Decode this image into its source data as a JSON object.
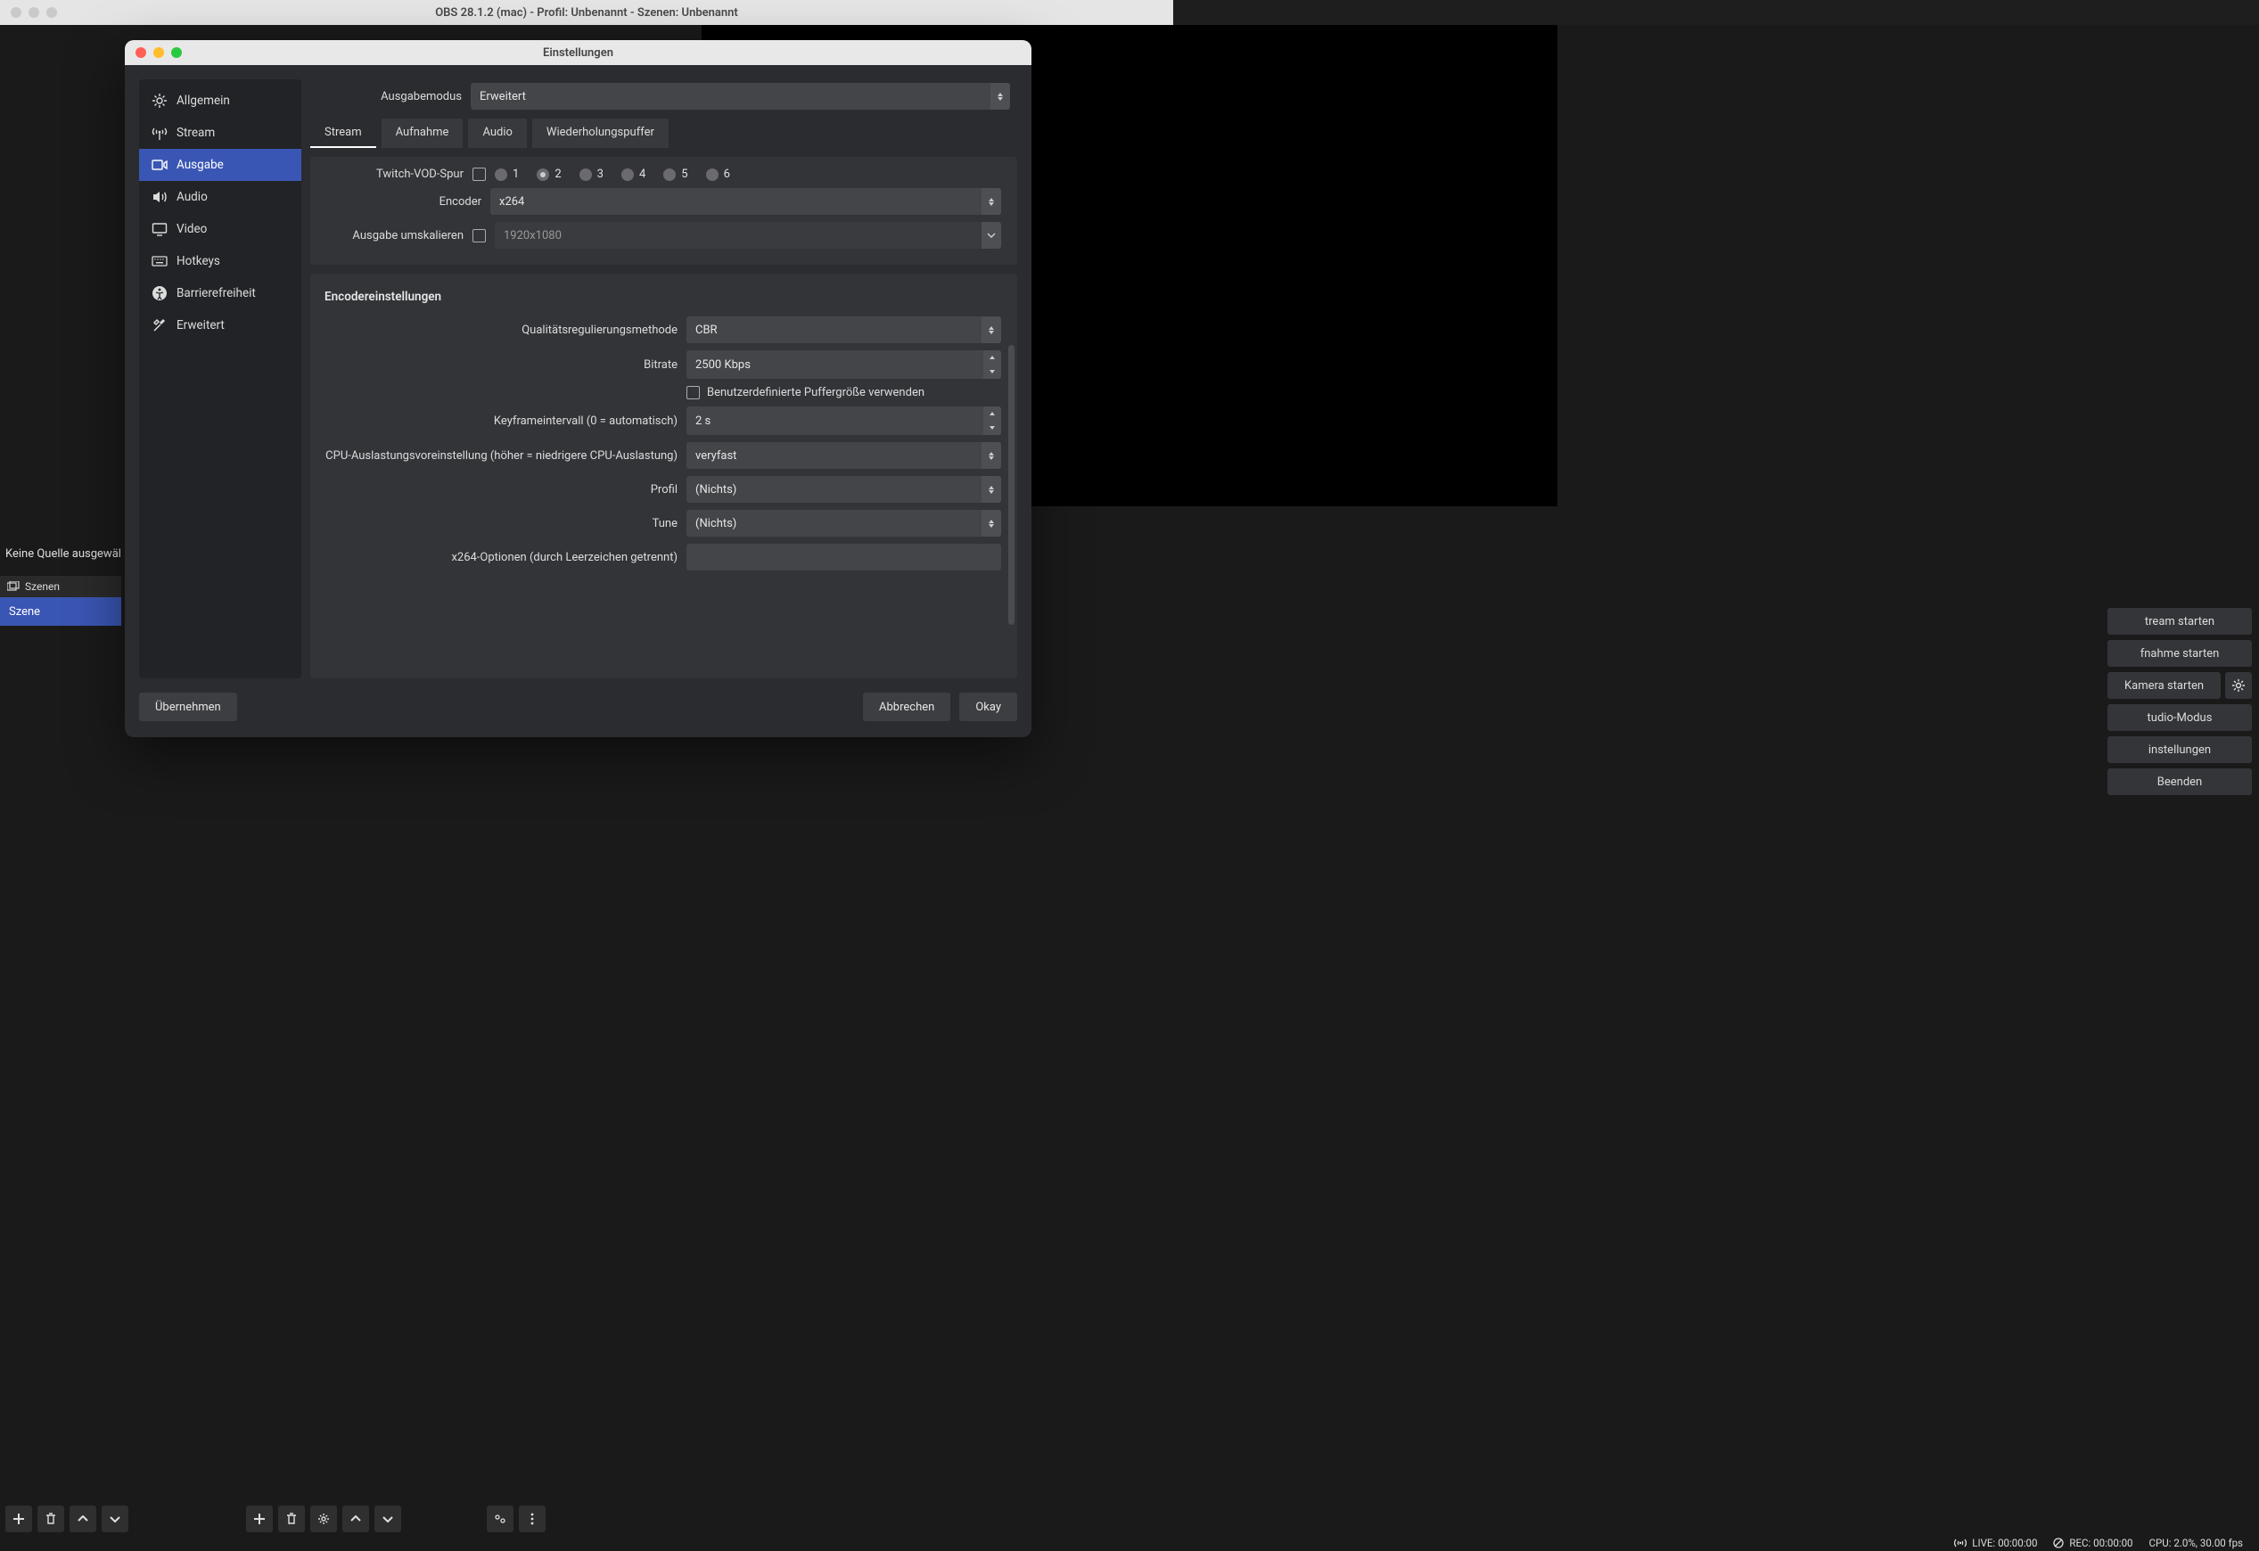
{
  "main_window": {
    "title": "OBS 28.1.2 (mac) - Profil: Unbenannt - Szenen: Unbenannt",
    "no_source_text": "Keine Quelle ausgewäl",
    "scenes_header": "Szenen",
    "scene_item": "Szene",
    "right_buttons": {
      "stream": "tream starten",
      "record": "fnahme starten",
      "camera": "Kamera starten",
      "studio": "tudio-Modus",
      "settings": "instellungen",
      "quit": "Beenden"
    }
  },
  "status_bar": {
    "live": "LIVE: 00:00:00",
    "rec": "REC: 00:00:00",
    "cpu": "CPU: 2.0%, 30.00 fps"
  },
  "settings": {
    "title": "Einstellungen",
    "sidebar": [
      {
        "label": "Allgemein"
      },
      {
        "label": "Stream"
      },
      {
        "label": "Ausgabe"
      },
      {
        "label": "Audio"
      },
      {
        "label": "Video"
      },
      {
        "label": "Hotkeys"
      },
      {
        "label": "Barrierefreiheit"
      },
      {
        "label": "Erweitert"
      }
    ],
    "output_mode_label": "Ausgabemodus",
    "output_mode_value": "Erweitert",
    "tabs": [
      {
        "label": "Stream"
      },
      {
        "label": "Aufnahme"
      },
      {
        "label": "Audio"
      },
      {
        "label": "Wiederholungspuffer"
      }
    ],
    "twitch_vod_label": "Twitch-VOD-Spur",
    "tracks": [
      "1",
      "2",
      "3",
      "4",
      "5",
      "6"
    ],
    "encoder_label": "Encoder",
    "encoder_value": "x264",
    "rescale_label": "Ausgabe umskalieren",
    "rescale_value": "1920x1080",
    "encoder_settings_title": "Encodereinstellungen",
    "rate_control_label": "Qualitätsregulierungsmethode",
    "rate_control_value": "CBR",
    "bitrate_label": "Bitrate",
    "bitrate_value": "2500 Kbps",
    "custom_buffer_label": "Benutzerdefinierte Puffergröße verwenden",
    "keyframe_label": "Keyframeintervall (0 = automatisch)",
    "keyframe_value": "2 s",
    "cpu_preset_label": "CPU-Auslastungsvoreinstellung (höher = niedrigere CPU-Auslastung)",
    "cpu_preset_value": "veryfast",
    "profile_label": "Profil",
    "profile_value": "(Nichts)",
    "tune_label": "Tune",
    "tune_value": "(Nichts)",
    "x264_opts_label": "x264-Optionen (durch Leerzeichen getrennt)",
    "footer": {
      "apply": "Übernehmen",
      "cancel": "Abbrechen",
      "ok": "Okay"
    }
  }
}
